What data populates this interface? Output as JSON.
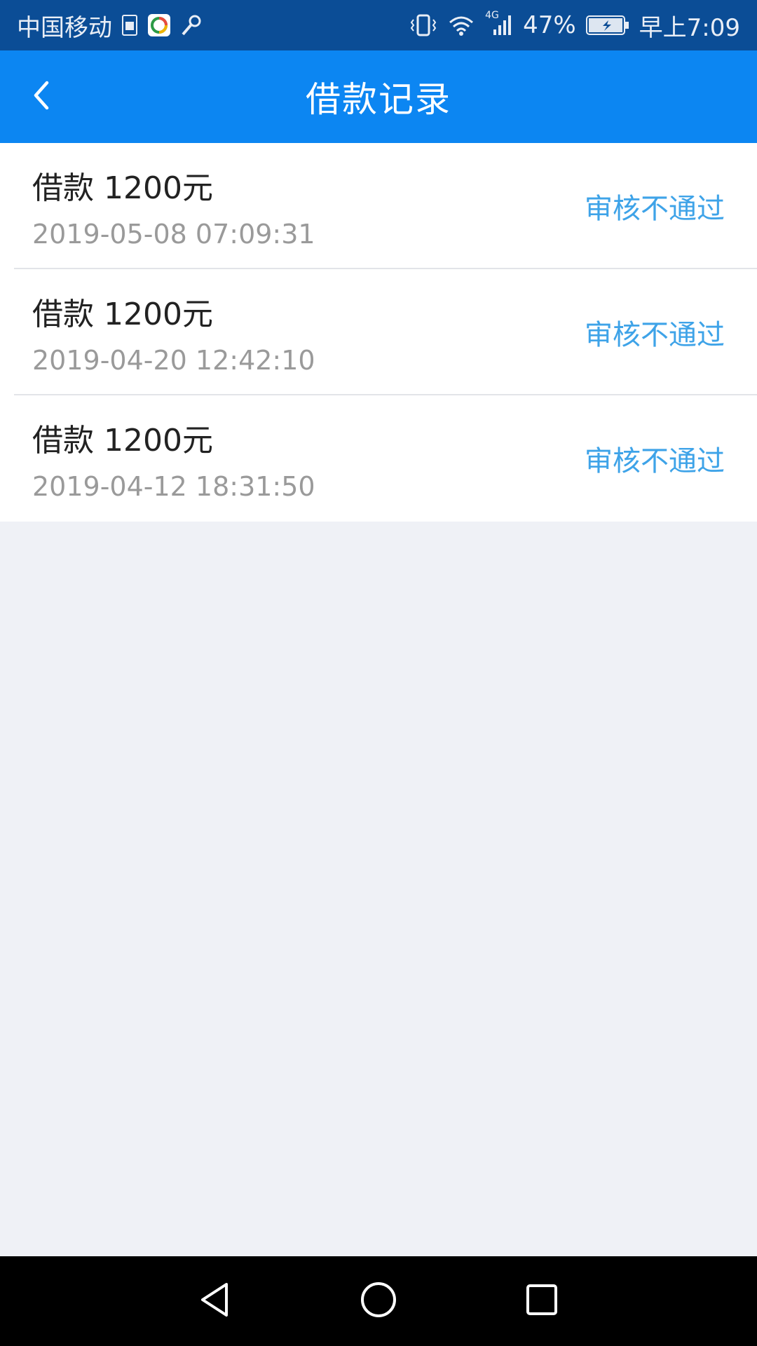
{
  "status_bar": {
    "carrier": "中国移动",
    "network": "4G",
    "battery": "47%",
    "time": "早上7:09"
  },
  "header": {
    "title": "借款记录",
    "back_icon": "chevron-left-icon"
  },
  "records": [
    {
      "amount": "借款 1200元",
      "time": "2019-05-08 07:09:31",
      "status": "审核不通过"
    },
    {
      "amount": "借款 1200元",
      "time": "2019-04-20 12:42:10",
      "status": "审核不通过"
    },
    {
      "amount": "借款 1200元",
      "time": "2019-04-12 18:31:50",
      "status": "审核不通过"
    }
  ],
  "nav_bar": {
    "back_icon": "triangle-back-icon",
    "home_icon": "circle-home-icon",
    "recents_icon": "square-recents-icon"
  },
  "colors": {
    "status_bar": "#0b4d96",
    "header": "#0c86f2",
    "status_text": "#3ea3e8",
    "background": "#eff1f6"
  }
}
